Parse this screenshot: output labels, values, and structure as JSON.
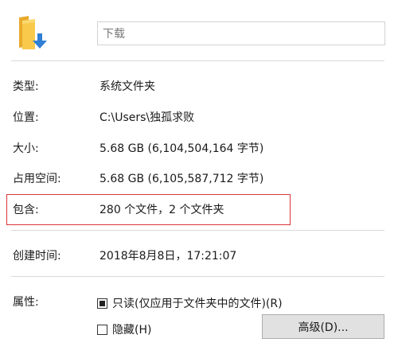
{
  "header": {
    "icon": "folder-download-icon",
    "name_value": "下载"
  },
  "properties": {
    "type": {
      "label": "类型:",
      "value": "系统文件夹"
    },
    "location": {
      "label": "位置:",
      "value": "C:\\Users\\独孤求败"
    },
    "size": {
      "label": "大小:",
      "value": "5.68 GB (6,104,504,164 字节)"
    },
    "size_on_disk": {
      "label": "占用空间:",
      "value": "5.68 GB (6,105,587,712 字节)"
    },
    "contains": {
      "label": "包含:",
      "value": "280 个文件，2 个文件夹"
    },
    "created": {
      "label": "创建时间:",
      "value": "2018年8月8日，17:21:07"
    }
  },
  "attributes": {
    "label": "属性:",
    "readonly_label": "只读(仅应用于文件夹中的文件)(R)",
    "readonly_state": "indeterminate",
    "hidden_label": "隐藏(H)",
    "hidden_state": "unchecked",
    "advanced_button": "高级(D)..."
  },
  "colors": {
    "highlight": "#d9343a",
    "folder_yellow": "#f8c94b",
    "arrow_blue": "#2f7fd4"
  }
}
